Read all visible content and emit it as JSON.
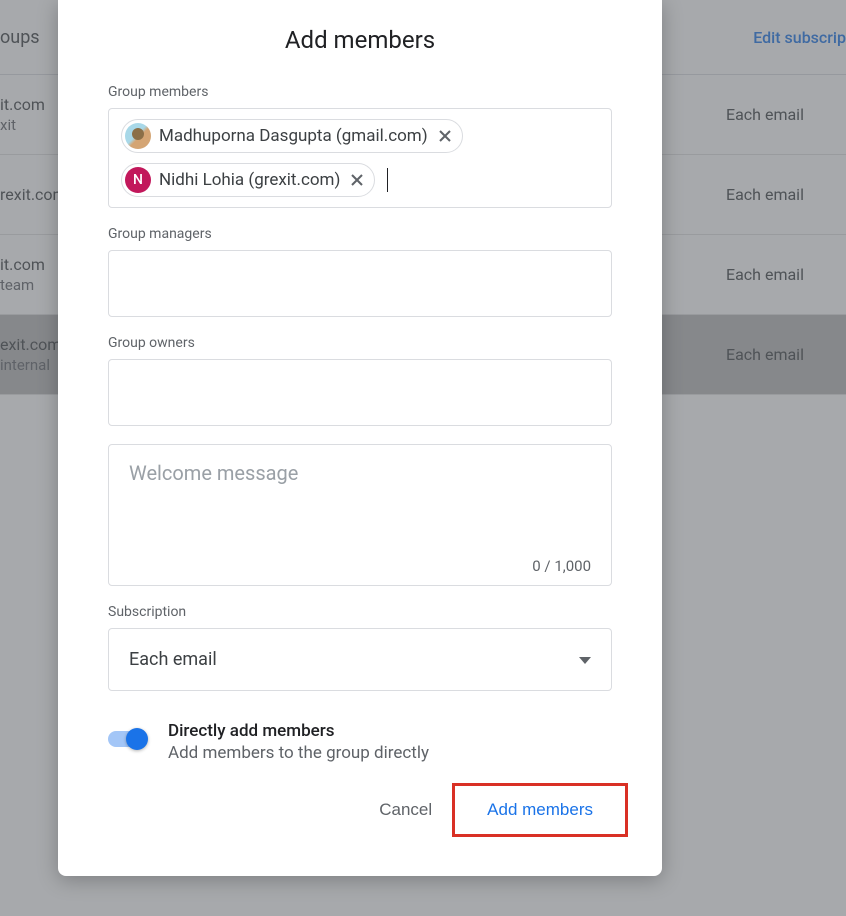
{
  "background": {
    "header_left": "oups",
    "edit_link": "Edit subscrip",
    "rows": [
      {
        "line1": "it.com",
        "line2": "xit",
        "right": "Each email"
      },
      {
        "line1": "rexit.com",
        "line2": "",
        "right": "Each email"
      },
      {
        "line1": "it.com",
        "line2": "team",
        "right": "Each email"
      },
      {
        "line1": "exit.com",
        "line2": "internal",
        "right": "Each email"
      }
    ]
  },
  "dialog": {
    "title": "Add members",
    "members_label": "Group members",
    "members": [
      {
        "avatar_type": "img",
        "letter": "",
        "name": "Madhuporna Dasgupta (gmail.com)"
      },
      {
        "avatar_type": "letter",
        "letter": "N",
        "name": "Nidhi Lohia (grexit.com)"
      }
    ],
    "managers_label": "Group managers",
    "owners_label": "Group owners",
    "welcome_placeholder": "Welcome message",
    "char_count": "0 / 1,000",
    "subscription_label": "Subscription",
    "subscription_value": "Each email",
    "toggle_title": "Directly add members",
    "toggle_sub": "Add members to the group directly",
    "cancel": "Cancel",
    "submit": "Add members"
  }
}
